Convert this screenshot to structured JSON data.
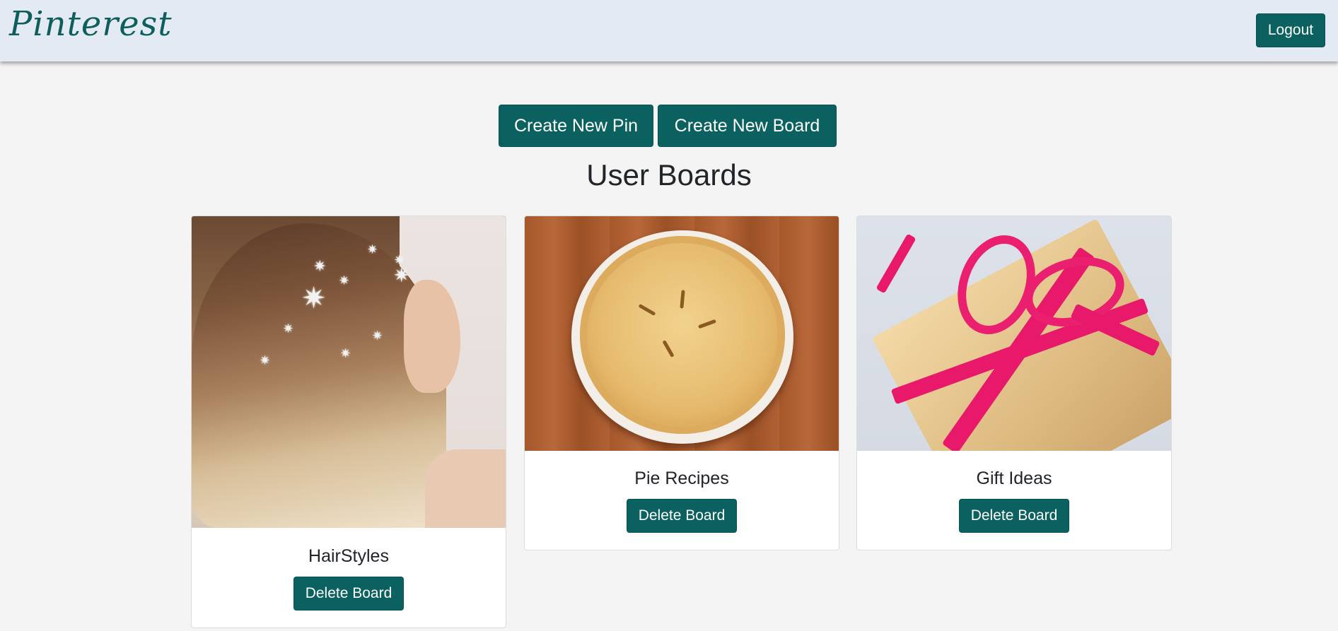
{
  "navbar": {
    "brand": "Pinterest",
    "logout_label": "Logout"
  },
  "actions": {
    "create_pin_label": "Create New Pin",
    "create_board_label": "Create New Board"
  },
  "page_title": "User Boards",
  "boards": [
    {
      "title": "HairStyles",
      "delete_label": "Delete Board",
      "image": "woman-hair-with-star-pins"
    },
    {
      "title": "Pie Recipes",
      "delete_label": "Delete Board",
      "image": "baked-pie-on-wood"
    },
    {
      "title": "Gift Ideas",
      "delete_label": "Delete Board",
      "image": "gift-box-with-pink-ribbon"
    }
  ],
  "colors": {
    "accent": "#0b6060",
    "navbar_bg": "#e4eaf4",
    "page_bg": "#f4f4f4"
  }
}
